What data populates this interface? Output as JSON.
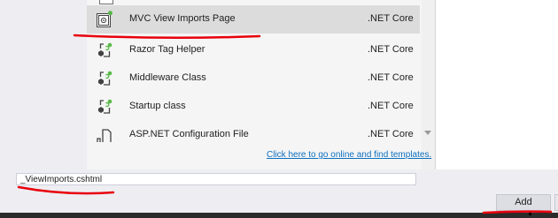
{
  "templates": [
    {
      "name": "MVC View Imports Page",
      "language": ".NET Core",
      "icon": "mvc-page-icon",
      "selected": true
    },
    {
      "name": "Razor Tag Helper",
      "language": ".NET Core",
      "icon": "csharp-class-icon",
      "selected": false
    },
    {
      "name": "Middleware Class",
      "language": ".NET Core",
      "icon": "csharp-class-icon",
      "selected": false
    },
    {
      "name": "Startup class",
      "language": ".NET Core",
      "icon": "csharp-class-icon",
      "selected": false
    },
    {
      "name": "ASP.NET Configuration File",
      "language": ".NET Core",
      "icon": "config-file-icon",
      "selected": false
    }
  ],
  "online_link": "Click here to go online and find templates.",
  "name_field": {
    "value": "_ViewImports.cshtml"
  },
  "buttons": {
    "add_label": "Add"
  },
  "colors": {
    "link": "#0e70c0",
    "selected_row": "#dcdcdc",
    "annotation": "#e8000b",
    "accent_green": "#58b947"
  }
}
